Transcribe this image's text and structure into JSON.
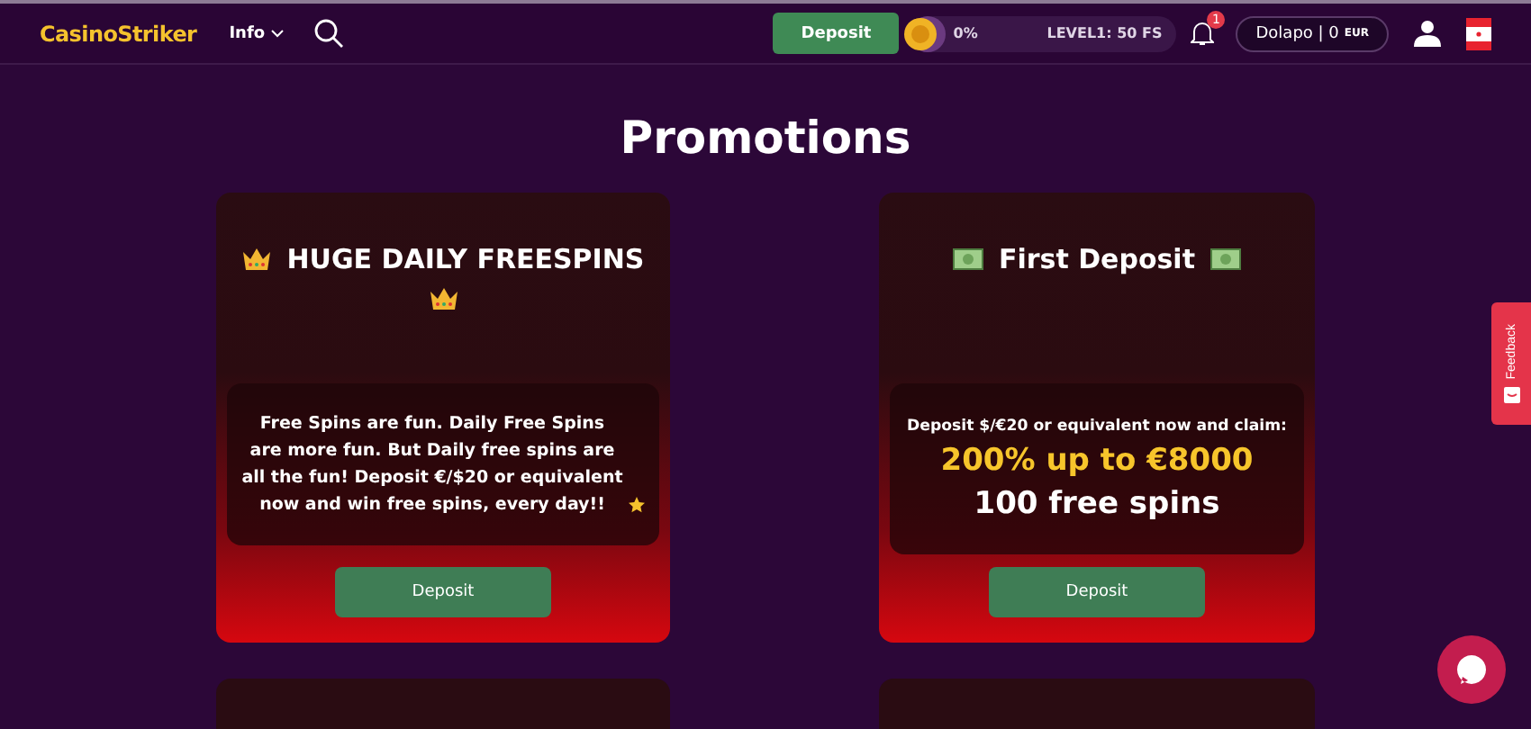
{
  "header": {
    "logo": "CasinoStriker",
    "menu": "Info",
    "deposit_button": "Deposit",
    "progress": {
      "percent": "0%",
      "level": 0,
      "reward": "LEVEL1: 50 FS"
    },
    "notifications": "1",
    "account": {
      "name": "Dolapo | 0",
      "currency": "EUR"
    }
  },
  "page_title": "Promotions",
  "promotions": [
    {
      "kind": "text",
      "title": "HUGE DAILY FREESPINS",
      "body": "Free Spins are fun. Daily Free Spins are more fun. But Daily free spins are all the fun! Deposit €/$20 or equivalent now and win free spins, every day!!",
      "button": "Deposit"
    },
    {
      "kind": "offer",
      "title": "First Deposit",
      "intro": "Deposit $/€20 or equivalent now and claim:",
      "highlight": "200% up to €8000",
      "extra": "100 free spins",
      "button": "Deposit"
    }
  ],
  "feedback_tab": "Feedback"
}
